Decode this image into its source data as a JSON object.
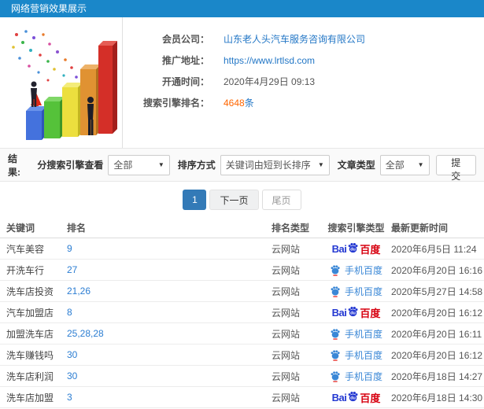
{
  "header": {
    "title": "网络营销效果展示"
  },
  "info": {
    "company_label": "会员公司：",
    "company_value": "山东老人头汽车服务咨询有限公司",
    "url_label": "推广地址：",
    "url_value": "https://www.lrtlsd.com",
    "open_time_label": "开通时间：",
    "open_time_value": "2020年4月29日 09:13",
    "rank_label": "搜索引擎排名：",
    "rank_value": "4648",
    "rank_unit": "条"
  },
  "filters": {
    "section_label": "结果:",
    "engine_label": "分搜索引擎查看",
    "engine_value": "全部",
    "sort_label": "排序方式",
    "sort_value": "关键词由短到长排序",
    "type_label": "文章类型",
    "type_value": "全部",
    "submit_label": "提交",
    "caret": "▼"
  },
  "pagination": {
    "current": "1",
    "next": "下一页",
    "last": "尾页"
  },
  "table": {
    "headers": [
      "关键词",
      "排名",
      "排名类型",
      "搜索引擎类型",
      "最新更新时间"
    ],
    "rows": [
      {
        "keyword": "汽车美容",
        "rank": "9",
        "rank_type": "云网站",
        "engine": "baidu-pc",
        "time": "2020年6月5日 11:24"
      },
      {
        "keyword": "开洗车行",
        "rank": "27",
        "rank_type": "云网站",
        "engine": "baidu-mobile",
        "time": "2020年6月20日 16:16"
      },
      {
        "keyword": "洗车店投资",
        "rank": "21,26",
        "rank_type": "云网站",
        "engine": "baidu-mobile",
        "time": "2020年5月27日 14:58"
      },
      {
        "keyword": "汽车加盟店",
        "rank": "8",
        "rank_type": "云网站",
        "engine": "baidu-pc",
        "time": "2020年6月20日 16:12"
      },
      {
        "keyword": "加盟洗车店",
        "rank": "25,28,28",
        "rank_type": "云网站",
        "engine": "baidu-mobile",
        "time": "2020年6月20日 16:11"
      },
      {
        "keyword": "洗车赚钱吗",
        "rank": "30",
        "rank_type": "云网站",
        "engine": "baidu-mobile",
        "time": "2020年6月20日 16:12"
      },
      {
        "keyword": "洗车店利润",
        "rank": "30",
        "rank_type": "云网站",
        "engine": "baidu-mobile",
        "time": "2020年6月18日 14:27"
      },
      {
        "keyword": "洗车店加盟",
        "rank": "3",
        "rank_type": "云网站",
        "engine": "baidu-pc",
        "time": "2020年6月18日 14:30"
      }
    ]
  },
  "baidu": {
    "pc_bai": "Bai",
    "pc_du": "du",
    "pc_suffix": "百度",
    "mobile_label": "手机百度"
  },
  "colors": {
    "topbar_blue": "#1a87c9",
    "link_blue": "#2377c6",
    "highlight_orange": "#ff6600",
    "active_page_blue": "#337ab7",
    "baidu_blue": "#2439d2",
    "baidu_red": "#d7000f",
    "mobile_blue": "#3a87d6"
  }
}
